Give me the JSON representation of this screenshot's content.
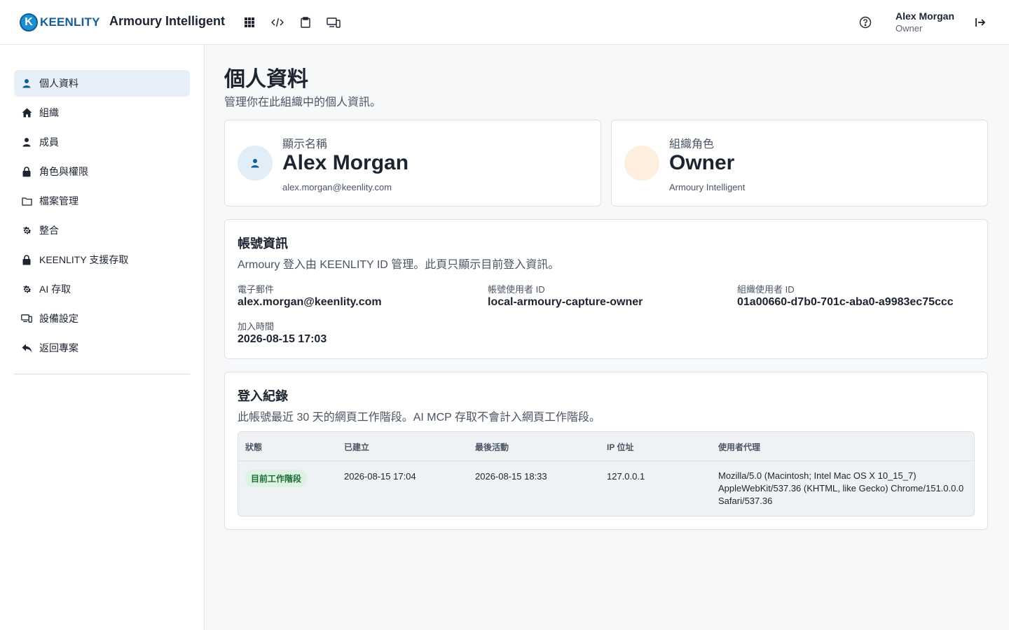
{
  "header": {
    "logo_text": "KEENLITY",
    "logo_letter": "K",
    "app_title": "Armoury Intelligent",
    "toolbar_icons": [
      "grid-icon",
      "code-icon",
      "clipboard-icon",
      "devices-icon"
    ],
    "user_name": "Alex Morgan",
    "user_role": "Owner"
  },
  "sidebar": {
    "items": [
      {
        "label": "個人資料",
        "icon": "user-icon",
        "active": true
      },
      {
        "label": "組織",
        "icon": "home-icon"
      },
      {
        "label": "成員",
        "icon": "user-icon"
      },
      {
        "label": "角色與權限",
        "icon": "lock-icon"
      },
      {
        "label": "檔案管理",
        "icon": "folder-icon"
      },
      {
        "label": "整合",
        "icon": "gear-icon"
      },
      {
        "label": "KEENLITY 支援存取",
        "icon": "lock-icon"
      },
      {
        "label": "AI 存取",
        "icon": "gear-icon"
      },
      {
        "label": "設備設定",
        "icon": "devices-icon"
      },
      {
        "label": "返回專案",
        "icon": "reply-icon"
      }
    ]
  },
  "page": {
    "title": "個人資料",
    "subtitle": "管理你在此組織中的個人資訊。"
  },
  "profile_card": {
    "label": "顯示名稱",
    "name": "Alex Morgan",
    "email": "alex.morgan@keenlity.com"
  },
  "role_card": {
    "label": "組織角色",
    "role": "Owner",
    "org": "Armoury Intelligent"
  },
  "account": {
    "title": "帳號資訊",
    "subtitle": "Armoury 登入由 KEENLITY ID 管理。此頁只顯示目前登入資訊。",
    "email_label": "電子郵件",
    "email": "alex.morgan@keenlity.com",
    "account_id_label": "帳號使用者 ID",
    "account_id": "local-armoury-capture-owner",
    "org_user_id_label": "組織使用者 ID",
    "org_user_id": "01a00660-d7b0-701c-aba0-a9983ec75ccc",
    "joined_label": "加入時間",
    "joined": "2026-08-15 17:03"
  },
  "logins": {
    "title": "登入紀錄",
    "subtitle": "此帳號最近 30 天的網頁工作階段。AI MCP 存取不會計入網頁工作階段。",
    "columns": [
      "狀態",
      "已建立",
      "最後活動",
      "IP 位址",
      "使用者代理"
    ],
    "rows": [
      {
        "status": "目前工作階段",
        "created": "2026-08-15 17:04",
        "last_active": "2026-08-15 18:33",
        "ip": "127.0.0.1",
        "user_agent": "Mozilla/5.0 (Macintosh; Intel Mac OS X 10_15_7) AppleWebKit/537.36 (KHTML, like Gecko) Chrome/151.0.0.0 Safari/537.36"
      }
    ]
  },
  "colors": {
    "accent": "#135e96",
    "active_nav_bg": "#e7f0f8",
    "avatar_user_bg": "#e1edf7",
    "avatar_role_bg": "#fdeedd",
    "badge_bg": "#dcf3e3",
    "badge_text": "#1e6b36"
  }
}
